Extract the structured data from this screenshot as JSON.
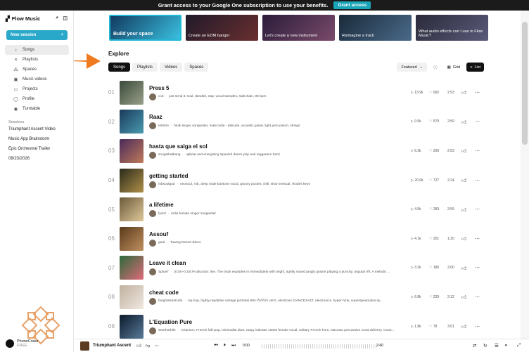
{
  "banner": {
    "text": "Grant access to your Google One subscription to use your benefits.",
    "button": "Grant access"
  },
  "sidebar": {
    "app_name": "Flow Music",
    "new_session": "New session",
    "nav": [
      {
        "label": "Songs",
        "icon": "music-note-icon",
        "active": true
      },
      {
        "label": "Playlists",
        "icon": "playlist-icon"
      },
      {
        "label": "Spaces",
        "icon": "spaces-icon"
      },
      {
        "label": "Music videos",
        "icon": "video-icon"
      },
      {
        "label": "Projects",
        "icon": "folder-icon"
      },
      {
        "label": "Profile",
        "icon": "user-icon"
      },
      {
        "label": "Turntable",
        "icon": "turntable-icon"
      }
    ],
    "sessions_title": "Sessions",
    "sessions": [
      "Triumphant Ascent Video",
      "Music App Brainstorm",
      "Epic Orchestral Trailer",
      "08/23/2026"
    ],
    "user": {
      "name": "PhonoCrass",
      "plan": "FREE"
    }
  },
  "cards": [
    "Build your space",
    "Create an EDM banger",
    "Let's create a new instrument",
    "Reimagine a track",
    "What audio effects can I use in Flow Music?"
  ],
  "explore": {
    "title": "Explore",
    "filters": [
      "Songs",
      "Playlists",
      "Videos",
      "Spaces"
    ],
    "sort": "Featured",
    "view_grid": "Grid",
    "view_list": "List"
  },
  "songs": [
    {
      "n": "01",
      "title": "Press 5",
      "artist": "ccd",
      "desc": "just send it: soul, dündük, trap, vocal samples, sidechain, 90 bpm",
      "plays": "13.9k",
      "likes": "692",
      "dur": "2:53"
    },
    {
      "n": "02",
      "title": "Raaz",
      "artist": "tehrie0",
      "desc": "hindi singer songwriter, male indie - delicate, acoustic guitar, light percussion, strings",
      "plays": "9.9k",
      "likes": "570",
      "dur": "2:59"
    },
    {
      "n": "03",
      "title": "hasta que salga el sol",
      "artist": "songsthatbang",
      "desc": "upbeat and energizing Spanish dance pop and reggaeton track",
      "plays": "6.3k",
      "likes": "206",
      "dur": "2:53"
    },
    {
      "n": "04",
      "title": "getting started",
      "artist": "mbsoulgod",
      "desc": "neosoul, rnb, deep male baritone vocal, groovy pocket, chill, slow sensual, rhodes keys",
      "plays": "20.9k",
      "likes": "727",
      "dur": "2:24"
    },
    {
      "n": "05",
      "title": "a lifetime",
      "artist": "fyord",
      "desc": "indie female singer songwriter",
      "plays": "4.5k",
      "likes": "283",
      "dur": "2:59"
    },
    {
      "n": "06",
      "title": "Assouf",
      "artist": "goal",
      "desc": "Tuareg Desert Blues",
      "plays": "4.1k",
      "likes": "201",
      "dur": "1:20"
    },
    {
      "n": "07",
      "title": "Leave it clean",
      "artist": "SplueT",
      "desc": "[0:00–0:18] Production: live. The track explodes in immediately with bright, tightly muted jangly guitars playing a punchy, angular riff. A melodic ...",
      "plays": "3.3k",
      "likes": "180",
      "dur": "2:00"
    },
    {
      "n": "08",
      "title": "cheat code",
      "artist": "freightstreetcafe",
      "desc": "nip hop, highly repetitive vintage jazzstep 90s //\\\\//\\\\//\\\\ UKG, electronic DANCEJAZZ, electronics, hyper-funk, superspeed plus sy...",
      "plays": "6.8k",
      "likes": "229",
      "dur": "2:12"
    },
    {
      "n": "09",
      "title": "L'Equation Pure",
      "artist": "WorthWhile",
      "desc": "Chanson, French folk-pop, minimalist duet, raspy intimate 1940s female vocal, solitary French horn, staccato percussive vocal delivery, count...",
      "plays": "1.8k",
      "likes": "78",
      "dur": "3:01"
    }
  ],
  "player": {
    "title": "Triumphant Ascent",
    "time_start": "0:00",
    "time_end": "2:40"
  },
  "colors": {
    "accent": "#2aa8c9",
    "arrow": "#f07a1f",
    "deco": "#e7a26a"
  }
}
